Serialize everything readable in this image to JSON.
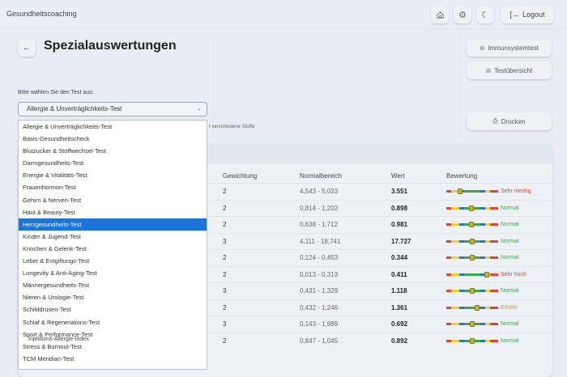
{
  "app": {
    "title": "Gesundheitscoaching",
    "logout_label": "Logout",
    "icons": [
      "home-icon",
      "gear-icon",
      "moon-icon",
      "logout-icon"
    ]
  },
  "page": {
    "title": "Spezialauswertungen"
  },
  "right_buttons": {
    "immunsystem": "Immunsystemtest",
    "testuebersicht": "Testübersicht",
    "drucken": "Drucken"
  },
  "select": {
    "label": "Bitte wählen Sie den Test aus:",
    "value": "Allergie & Unverträglichkeits-Test",
    "description_fragment": "t verschiedene Stoffe",
    "options": [
      "Allergie & Unverträglichkeits-Test",
      "Basis-Gesundheitscheck",
      "Blutzucker & Stoffwechsel-Test",
      "Darmgesundheits-Test",
      "Energie & Vitalitäts-Test",
      "Frauenhormon-Test",
      "Gehirn & Nerven-Test",
      "Haut & Beauty-Test",
      "Herzgesundheits-Test",
      "Kinder & Jugend-Test",
      "Knochen & Gelenk-Test",
      "Leber & Entgiftungs-Test",
      "Longevity & Anti-Aging-Test",
      "Männergesundheits-Test",
      "Nieren & Urologie-Test",
      "Schilddrüsen-Test",
      "Schlaf & Regenerations-Test",
      "Sport & Performance-Test",
      "Stress & Burnout-Test",
      "TCM Meridian-Test"
    ],
    "highlighted": "Herzgesundheits-Test"
  },
  "table": {
    "headers": {
      "gewichtung": "Gewichtung",
      "normalbereich": "Normalbereich",
      "wert": "Wert",
      "bewertung": "Bewertung"
    },
    "rows": [
      {
        "name": "",
        "gewichtung": "2",
        "normalbereich": "4,543 - 5,023",
        "wert": "3.551",
        "bewertung": "Sehr niedrig",
        "level": 0.27,
        "tone": "red"
      },
      {
        "name": "",
        "gewichtung": "2",
        "normalbereich": "0,814 - 1,202",
        "wert": "0.898",
        "bewertung": "Normal",
        "level": 0.48,
        "tone": "green"
      },
      {
        "name": "",
        "gewichtung": "2",
        "normalbereich": "0,638 - 1,712",
        "wert": "0.981",
        "bewertung": "Normal",
        "level": 0.48,
        "tone": "green"
      },
      {
        "name": "",
        "gewichtung": "3",
        "normalbereich": "4,111 - 18,741",
        "wert": "17.727",
        "bewertung": "Normal",
        "level": 0.5,
        "tone": "green"
      },
      {
        "name": "",
        "gewichtung": "2",
        "normalbereich": "0,124 - 0,453",
        "wert": "0.344",
        "bewertung": "Normal",
        "level": 0.5,
        "tone": "green"
      },
      {
        "name": "",
        "gewichtung": "2",
        "normalbereich": "0,013 - 0,313",
        "wert": "0.411",
        "bewertung": "Sehr hoch",
        "level": 0.78,
        "tone": "red"
      },
      {
        "name": "",
        "gewichtung": "3",
        "normalbereich": "0,431 - 1,329",
        "wert": "1.118",
        "bewertung": "Normal",
        "level": 0.5,
        "tone": "green"
      },
      {
        "name": "",
        "gewichtung": "2",
        "normalbereich": "0,432 - 1,246",
        "wert": "1.361",
        "bewertung": "Erhöht",
        "level": 0.6,
        "tone": "orange"
      },
      {
        "name": "",
        "gewichtung": "3",
        "normalbereich": "0,143 - 1,989",
        "wert": "0.692",
        "bewertung": "Normal",
        "level": 0.5,
        "tone": "green"
      },
      {
        "name": "Injektions-Allergie-Index",
        "gewichtung": "2",
        "normalbereich": "0,847 - 1,045",
        "wert": "0.892",
        "bewertung": "Normal",
        "level": 0.5,
        "tone": "green"
      }
    ]
  },
  "colors": {
    "accent": "#1e74d9",
    "green": "#3aa84a",
    "red": "#e0453b",
    "orange": "#f08a24",
    "yellow": "#e9d22a",
    "blue": "#2f6fd6"
  }
}
